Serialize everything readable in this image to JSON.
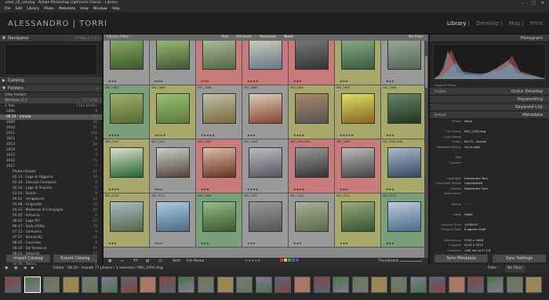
{
  "title": "xlast_LR_catalog - Adobe Photoshop Lightroom Classic - Library",
  "menu": [
    "File",
    "Edit",
    "Library",
    "Photo",
    "Metadata",
    "View",
    "Window",
    "Help"
  ],
  "identity": "ALESSANDRO | TORRI",
  "modules": [
    "Library",
    "Develop",
    "Map",
    "Print"
  ],
  "left": {
    "navigator": "Navigator",
    "nav_zoom": "FIT  FILL  1:1  3:1",
    "catalog": "Catalog",
    "folders": "Folders",
    "filter_folders": "Filter Folders",
    "drive": "Windows (C:)",
    "drive_info": "1 / 2 TB",
    "count_label": "1 Year",
    "count": "1184 photos",
    "folders_list": [
      {
        "n": "2008",
        "c": "8"
      },
      {
        "n": "08.20 - Irlanda",
        "c": "77",
        "sel": true
      },
      {
        "n": "2009",
        "c": "10"
      },
      {
        "n": "2010",
        "c": "31"
      },
      {
        "n": "2011",
        "c": "119"
      },
      {
        "n": "2012",
        "c": "8"
      },
      {
        "n": "2013",
        "c": "16"
      },
      {
        "n": "2014",
        "c": "2"
      },
      {
        "n": "2015",
        "c": "2"
      },
      {
        "n": "2016",
        "c": "71"
      },
      {
        "n": "2017",
        "c": "7"
      },
      {
        "n": "Photo+Frozen",
        "c": "31"
      },
      {
        "n": "02.13 - Lago di Oggiono",
        "c": "16"
      },
      {
        "n": "02.19 - Cascate Formazza",
        "c": "4"
      },
      {
        "n": "02.20 - Lago di Pusiano",
        "c": "9"
      },
      {
        "n": "03.24 - Scalini",
        "c": "8"
      },
      {
        "n": "04.01 - Varigasone",
        "c": "23"
      },
      {
        "n": "04.08 - Grignetta",
        "c": "14"
      },
      {
        "n": "04.23 - Madonna di Campiglio",
        "c": "22"
      },
      {
        "n": "05.05 - Armonia",
        "c": "6"
      },
      {
        "n": "06.03 - Lago Pirl",
        "c": "12"
      },
      {
        "n": "06.17 - Isola d'Elba",
        "c": "25"
      },
      {
        "n": "07.11 - Comuano",
        "c": "9"
      },
      {
        "n": "07.27 - Strada N2",
        "c": "11"
      },
      {
        "n": "08.05 - Carimate",
        "c": "9"
      },
      {
        "n": "08.16 - Val Verzasca",
        "c": "15"
      },
      {
        "n": "08.23 - Dolomiti",
        "c": "27"
      },
      {
        "n": "10.07 - Alpe Devero",
        "c": "14"
      },
      {
        "n": "10.28 - Tellaro",
        "c": "6"
      },
      {
        "n": "11.07 - Lago Ghirla",
        "c": "5"
      }
    ],
    "import_btn": "Import Catalog",
    "export_btn": "Export Catalog"
  },
  "center": {
    "filter_label": "Library Filter :",
    "filter_tabs": [
      "Text",
      "Attribute",
      "Metadata",
      "None"
    ],
    "filter_right": "No Filter",
    "cells": [
      {
        "n": "IMG_2756",
        "st": "★★★",
        "bg": "#9a9a9a",
        "ph": [
          "#3a5a2a",
          "#88aa66"
        ]
      },
      {
        "n": "IMG_2761",
        "st": "★★★",
        "bg": "#9a9a9a",
        "ph": [
          "#445533",
          "#99bb77"
        ]
      },
      {
        "n": "IMG_2818",
        "st": "★★★",
        "bg": "#c97a7a",
        "ph": [
          "#556644",
          "#aabb99"
        ]
      },
      {
        "n": "IMG_2824",
        "st": "★★★★",
        "bg": "#c97a7a",
        "ph": [
          "#667788",
          "#ccccbb"
        ]
      },
      {
        "n": "IMG_2841",
        "st": "★★★",
        "bg": "#c97a7a",
        "ph": [
          "#333333",
          "#777777"
        ]
      },
      {
        "n": "IMG_2850",
        "st": "★★★",
        "bg": "#a8a86a",
        "ph": [
          "#3a5a3a",
          "#88aa88"
        ]
      },
      {
        "n": "IMG_2860",
        "st": "★★★",
        "bg": "#9a9a9a",
        "ph": [
          "#556655",
          "#99aa99"
        ]
      },
      {
        "n": "IMG_2862",
        "st": "★★★★",
        "bg": "#7aa07a",
        "ph": [
          "#556b2f",
          "#a0b070"
        ]
      },
      {
        "n": "IMG_2866",
        "st": "★★★★",
        "bg": "#a8a86a",
        "ph": [
          "#5a7a3a",
          "#9ac07a"
        ]
      },
      {
        "n": "IMG_2868",
        "st": "★★★★★",
        "bg": "#9a9a9a",
        "ph": [
          "#7a6a3a",
          "#c0c0aa"
        ]
      },
      {
        "n": "IMG_2880",
        "st": "★★★",
        "bg": "#9a9a9a",
        "ph": [
          "#884433",
          "#ddccbb"
        ]
      },
      {
        "n": "IMG_2885",
        "st": "★★★★",
        "bg": "#a8a86a",
        "ph": [
          "#555555",
          "#aa8866"
        ]
      },
      {
        "n": "IMG_2893",
        "st": "★★★★★",
        "bg": "#a8a86a",
        "ph": [
          "#886622",
          "#dddd66"
        ]
      },
      {
        "n": "IMG_2896",
        "st": "★★★",
        "bg": "#a8a86a",
        "ph": [
          "#223322",
          "#668866"
        ]
      },
      {
        "n": "IMG_2900",
        "st": "★★★★",
        "bg": "#a8a86a",
        "ph": [
          "#226633",
          "#ddddcc"
        ]
      },
      {
        "n": "IMG_2947",
        "st": "★★★",
        "bg": "#9a9a9a",
        "ph": [
          "#554433",
          "#cccccc"
        ]
      },
      {
        "n": "IMG_2955",
        "st": "★★★",
        "bg": "#c97a7a",
        "ph": [
          "#663322",
          "#ddbbaa"
        ]
      },
      {
        "n": "IMG_2965",
        "st": "★★★★",
        "bg": "#9a9a9a",
        "ph": [
          "#555566",
          "#bbbbbb"
        ]
      },
      {
        "n": "IMG_2990-Edit",
        "st": "★★★★",
        "bg": "#c97a7a",
        "ph": [
          "#333333",
          "#999999"
        ]
      },
      {
        "n": "IMG_3028",
        "st": "★★★",
        "bg": "#c97a7a",
        "ph": [
          "#444444",
          "#bbbbbb"
        ]
      },
      {
        "n": "IMG_3069-Edit",
        "st": "★★★",
        "bg": "#a8a86a",
        "ph": [
          "#334466",
          "#aabbcc"
        ]
      },
      {
        "n": "IMG_3158",
        "st": "★★★",
        "bg": "#a8a86a",
        "ph": [
          "#556644",
          "#aabbcc"
        ]
      },
      {
        "n": "IMG_3172",
        "st": "★★★",
        "bg": "#9a9a9a",
        "ph": [
          "#4a6a8a",
          "#aaccdd"
        ]
      },
      {
        "n": "IMG_3196",
        "st": "★★★",
        "bg": "#7aa07a",
        "ph": [
          "#3a5a2a",
          "#99bb88"
        ]
      },
      {
        "n": "IMG_3207",
        "st": "★★★",
        "bg": "#9a9a9a",
        "ph": [
          "#555555",
          "#999999"
        ]
      },
      {
        "n": "IMG_3214",
        "st": "★★★",
        "bg": "#9a9a9a",
        "ph": [
          "#5a6a4a",
          "#aab099"
        ]
      },
      {
        "n": "IMG_3225",
        "st": "★★★",
        "bg": "#a8a86a",
        "ph": [
          "#335533",
          "#99aa77"
        ]
      },
      {
        "n": "IMG_3231",
        "st": "★★★",
        "bg": "#7aa07a",
        "ph": [
          "#4a6a8a",
          "#bbccdd"
        ]
      }
    ],
    "sort_label": "Sort:",
    "sort_value": "File Name",
    "thumbs_label": "Thumbnails"
  },
  "right": {
    "histogram": "Histogram",
    "histo_info": "ISO 100   24 mm   f / 5.6   1/60 sec",
    "smart_preview": "Original Photo",
    "quick_develop": "Quick Develop",
    "custom": "Custom",
    "keywording": "Keywording",
    "keyword_list": "Keyword List",
    "metadata": "Metadata",
    "default": "Default",
    "meta": [
      {
        "k": "Preset",
        "v": "None"
      },
      {
        "k": "",
        "v": ""
      },
      {
        "k": "File Name",
        "v": "IMG_2450.dng"
      },
      {
        "k": "Copy Name",
        "v": ""
      },
      {
        "k": "Folder",
        "v": "08.20 - Irlanda"
      },
      {
        "k": "Metadata Status",
        "v": "Up to date"
      },
      {
        "k": "",
        "v": ""
      },
      {
        "k": "Title",
        "v": ""
      },
      {
        "k": "Caption",
        "v": ""
      },
      {
        "k": "",
        "v": ""
      },
      {
        "k": "",
        "v": ""
      },
      {
        "k": "Copyright",
        "v": "Alessandro Torri"
      },
      {
        "k": "Copyright Status",
        "v": "Copyrighted"
      },
      {
        "k": "Creator",
        "v": "Alessandro Torri"
      },
      {
        "k": "Sublocation",
        "v": ""
      },
      {
        "k": "",
        "v": ""
      },
      {
        "k": "Rating",
        "v": "· · · · ·"
      },
      {
        "k": "",
        "v": ""
      },
      {
        "k": "Label",
        "v": "Giallo"
      },
      {
        "k": "",
        "v": ""
      },
      {
        "k": "Capture Time",
        "v": "19:06:24"
      },
      {
        "k": "Capture Date",
        "v": "6 agosto 2008"
      },
      {
        "k": "",
        "v": ""
      },
      {
        "k": "Dimensions",
        "v": "2304 x 3456"
      },
      {
        "k": "Cropped",
        "v": "2143 x 3213"
      },
      {
        "k": "Exposure",
        "v": "1/60 sec at f / 5.6"
      },
      {
        "k": "Focal Length",
        "v": "23 mm"
      }
    ],
    "sync_meta": "Sync Metadata",
    "sync_settings": "Sync Settings"
  },
  "filmstrip": {
    "path": "Folder : 08.20 - Irlanda     77 photos / 1 selected / IMG_2450.dng",
    "filter": "Filter :",
    "filter_value": "No Filter"
  }
}
